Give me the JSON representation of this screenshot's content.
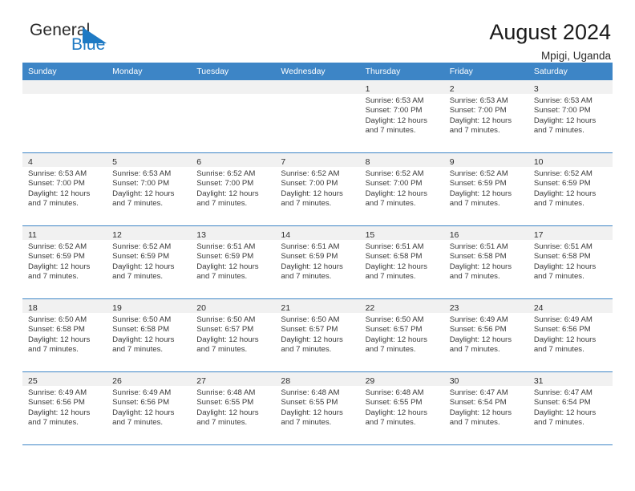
{
  "brand": {
    "name_part1": "General",
    "name_part2": "Blue",
    "accent_color": "#1f7ac4"
  },
  "header": {
    "title": "August 2024",
    "subtitle": "Mpigi, Uganda"
  },
  "calendar": {
    "header_bg": "#3d85c6",
    "daynum_bg": "#f1f1f1",
    "weekdays": [
      "Sunday",
      "Monday",
      "Tuesday",
      "Wednesday",
      "Thursday",
      "Friday",
      "Saturday"
    ],
    "weeks": [
      [
        {
          "day": "",
          "sunrise": "",
          "sunset": "",
          "daylight_line1": "",
          "daylight_line2": ""
        },
        {
          "day": "",
          "sunrise": "",
          "sunset": "",
          "daylight_line1": "",
          "daylight_line2": ""
        },
        {
          "day": "",
          "sunrise": "",
          "sunset": "",
          "daylight_line1": "",
          "daylight_line2": ""
        },
        {
          "day": "",
          "sunrise": "",
          "sunset": "",
          "daylight_line1": "",
          "daylight_line2": ""
        },
        {
          "day": "1",
          "sunrise": "Sunrise: 6:53 AM",
          "sunset": "Sunset: 7:00 PM",
          "daylight_line1": "Daylight: 12 hours",
          "daylight_line2": "and 7 minutes."
        },
        {
          "day": "2",
          "sunrise": "Sunrise: 6:53 AM",
          "sunset": "Sunset: 7:00 PM",
          "daylight_line1": "Daylight: 12 hours",
          "daylight_line2": "and 7 minutes."
        },
        {
          "day": "3",
          "sunrise": "Sunrise: 6:53 AM",
          "sunset": "Sunset: 7:00 PM",
          "daylight_line1": "Daylight: 12 hours",
          "daylight_line2": "and 7 minutes."
        }
      ],
      [
        {
          "day": "4",
          "sunrise": "Sunrise: 6:53 AM",
          "sunset": "Sunset: 7:00 PM",
          "daylight_line1": "Daylight: 12 hours",
          "daylight_line2": "and 7 minutes."
        },
        {
          "day": "5",
          "sunrise": "Sunrise: 6:53 AM",
          "sunset": "Sunset: 7:00 PM",
          "daylight_line1": "Daylight: 12 hours",
          "daylight_line2": "and 7 minutes."
        },
        {
          "day": "6",
          "sunrise": "Sunrise: 6:52 AM",
          "sunset": "Sunset: 7:00 PM",
          "daylight_line1": "Daylight: 12 hours",
          "daylight_line2": "and 7 minutes."
        },
        {
          "day": "7",
          "sunrise": "Sunrise: 6:52 AM",
          "sunset": "Sunset: 7:00 PM",
          "daylight_line1": "Daylight: 12 hours",
          "daylight_line2": "and 7 minutes."
        },
        {
          "day": "8",
          "sunrise": "Sunrise: 6:52 AM",
          "sunset": "Sunset: 7:00 PM",
          "daylight_line1": "Daylight: 12 hours",
          "daylight_line2": "and 7 minutes."
        },
        {
          "day": "9",
          "sunrise": "Sunrise: 6:52 AM",
          "sunset": "Sunset: 6:59 PM",
          "daylight_line1": "Daylight: 12 hours",
          "daylight_line2": "and 7 minutes."
        },
        {
          "day": "10",
          "sunrise": "Sunrise: 6:52 AM",
          "sunset": "Sunset: 6:59 PM",
          "daylight_line1": "Daylight: 12 hours",
          "daylight_line2": "and 7 minutes."
        }
      ],
      [
        {
          "day": "11",
          "sunrise": "Sunrise: 6:52 AM",
          "sunset": "Sunset: 6:59 PM",
          "daylight_line1": "Daylight: 12 hours",
          "daylight_line2": "and 7 minutes."
        },
        {
          "day": "12",
          "sunrise": "Sunrise: 6:52 AM",
          "sunset": "Sunset: 6:59 PM",
          "daylight_line1": "Daylight: 12 hours",
          "daylight_line2": "and 7 minutes."
        },
        {
          "day": "13",
          "sunrise": "Sunrise: 6:51 AM",
          "sunset": "Sunset: 6:59 PM",
          "daylight_line1": "Daylight: 12 hours",
          "daylight_line2": "and 7 minutes."
        },
        {
          "day": "14",
          "sunrise": "Sunrise: 6:51 AM",
          "sunset": "Sunset: 6:59 PM",
          "daylight_line1": "Daylight: 12 hours",
          "daylight_line2": "and 7 minutes."
        },
        {
          "day": "15",
          "sunrise": "Sunrise: 6:51 AM",
          "sunset": "Sunset: 6:58 PM",
          "daylight_line1": "Daylight: 12 hours",
          "daylight_line2": "and 7 minutes."
        },
        {
          "day": "16",
          "sunrise": "Sunrise: 6:51 AM",
          "sunset": "Sunset: 6:58 PM",
          "daylight_line1": "Daylight: 12 hours",
          "daylight_line2": "and 7 minutes."
        },
        {
          "day": "17",
          "sunrise": "Sunrise: 6:51 AM",
          "sunset": "Sunset: 6:58 PM",
          "daylight_line1": "Daylight: 12 hours",
          "daylight_line2": "and 7 minutes."
        }
      ],
      [
        {
          "day": "18",
          "sunrise": "Sunrise: 6:50 AM",
          "sunset": "Sunset: 6:58 PM",
          "daylight_line1": "Daylight: 12 hours",
          "daylight_line2": "and 7 minutes."
        },
        {
          "day": "19",
          "sunrise": "Sunrise: 6:50 AM",
          "sunset": "Sunset: 6:58 PM",
          "daylight_line1": "Daylight: 12 hours",
          "daylight_line2": "and 7 minutes."
        },
        {
          "day": "20",
          "sunrise": "Sunrise: 6:50 AM",
          "sunset": "Sunset: 6:57 PM",
          "daylight_line1": "Daylight: 12 hours",
          "daylight_line2": "and 7 minutes."
        },
        {
          "day": "21",
          "sunrise": "Sunrise: 6:50 AM",
          "sunset": "Sunset: 6:57 PM",
          "daylight_line1": "Daylight: 12 hours",
          "daylight_line2": "and 7 minutes."
        },
        {
          "day": "22",
          "sunrise": "Sunrise: 6:50 AM",
          "sunset": "Sunset: 6:57 PM",
          "daylight_line1": "Daylight: 12 hours",
          "daylight_line2": "and 7 minutes."
        },
        {
          "day": "23",
          "sunrise": "Sunrise: 6:49 AM",
          "sunset": "Sunset: 6:56 PM",
          "daylight_line1": "Daylight: 12 hours",
          "daylight_line2": "and 7 minutes."
        },
        {
          "day": "24",
          "sunrise": "Sunrise: 6:49 AM",
          "sunset": "Sunset: 6:56 PM",
          "daylight_line1": "Daylight: 12 hours",
          "daylight_line2": "and 7 minutes."
        }
      ],
      [
        {
          "day": "25",
          "sunrise": "Sunrise: 6:49 AM",
          "sunset": "Sunset: 6:56 PM",
          "daylight_line1": "Daylight: 12 hours",
          "daylight_line2": "and 7 minutes."
        },
        {
          "day": "26",
          "sunrise": "Sunrise: 6:49 AM",
          "sunset": "Sunset: 6:56 PM",
          "daylight_line1": "Daylight: 12 hours",
          "daylight_line2": "and 7 minutes."
        },
        {
          "day": "27",
          "sunrise": "Sunrise: 6:48 AM",
          "sunset": "Sunset: 6:55 PM",
          "daylight_line1": "Daylight: 12 hours",
          "daylight_line2": "and 7 minutes."
        },
        {
          "day": "28",
          "sunrise": "Sunrise: 6:48 AM",
          "sunset": "Sunset: 6:55 PM",
          "daylight_line1": "Daylight: 12 hours",
          "daylight_line2": "and 7 minutes."
        },
        {
          "day": "29",
          "sunrise": "Sunrise: 6:48 AM",
          "sunset": "Sunset: 6:55 PM",
          "daylight_line1": "Daylight: 12 hours",
          "daylight_line2": "and 7 minutes."
        },
        {
          "day": "30",
          "sunrise": "Sunrise: 6:47 AM",
          "sunset": "Sunset: 6:54 PM",
          "daylight_line1": "Daylight: 12 hours",
          "daylight_line2": "and 7 minutes."
        },
        {
          "day": "31",
          "sunrise": "Sunrise: 6:47 AM",
          "sunset": "Sunset: 6:54 PM",
          "daylight_line1": "Daylight: 12 hours",
          "daylight_line2": "and 7 minutes."
        }
      ]
    ]
  }
}
